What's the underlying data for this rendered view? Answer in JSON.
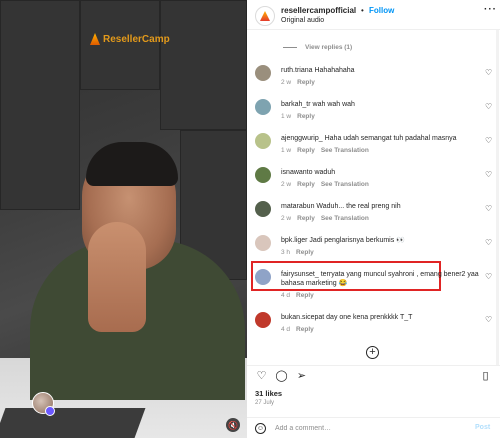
{
  "video": {
    "brand_text": "ResellerCamp"
  },
  "post": {
    "username": "resellercampofficial",
    "separator": "•",
    "follow_label": "Follow",
    "audio": "Original audio",
    "more_label": "···"
  },
  "view_replies": "View replies (1)",
  "comments": [
    {
      "user": "ruth.triana",
      "text": "Hahahahaha",
      "time": "2 w",
      "reply": "Reply",
      "translation": "",
      "avatar_color": "#9a8f7d"
    },
    {
      "user": "barkah_tr",
      "text": "wah wah wah",
      "time": "1 w",
      "reply": "Reply",
      "translation": "",
      "avatar_color": "#7ea3b0"
    },
    {
      "user": "ajenggwurip_",
      "text": "Haha udah semangat tuh padahal masnya",
      "time": "1 w",
      "reply": "Reply",
      "translation": "See Translation",
      "avatar_color": "#b8c28a"
    },
    {
      "user": "isnawanto",
      "text": "waduh",
      "time": "2 w",
      "reply": "Reply",
      "translation": "See Translation",
      "avatar_color": "#5f7a45"
    },
    {
      "user": "matarabun",
      "text": "Waduh... the real preng nih",
      "time": "2 w",
      "reply": "Reply",
      "translation": "See Translation",
      "avatar_color": "#54604c"
    },
    {
      "user": "bpk.liger",
      "text": "Jadi penglarisnya berkumis 👀",
      "time": "3 h",
      "reply": "Reply",
      "translation": "",
      "avatar_color": "#d9c6bc"
    },
    {
      "user": "fairysunset_",
      "text": "terryata yang muncul syahroni , emang bener2 yaa bahasa marketing 😂",
      "time": "4 d",
      "reply": "Reply",
      "translation": "",
      "avatar_color": "#8fa3c7"
    },
    {
      "user": "bukan.sicepat",
      "text": "day one kena prenkkkk T_T",
      "time": "4 d",
      "reply": "Reply",
      "translation": "",
      "avatar_color": "#c0392b"
    }
  ],
  "actions": {
    "like_icon": "heart-icon",
    "comment_icon": "comment-icon",
    "share_icon": "share-icon",
    "save_icon": "bookmark-icon",
    "likes": "31 likes",
    "date": "27 July"
  },
  "add_comment": {
    "placeholder": "Add a comment…",
    "post_label": "Post"
  },
  "colors": {
    "link_blue": "#0095f6",
    "muted": "#8e8e8e",
    "highlight_red": "#e02424"
  }
}
